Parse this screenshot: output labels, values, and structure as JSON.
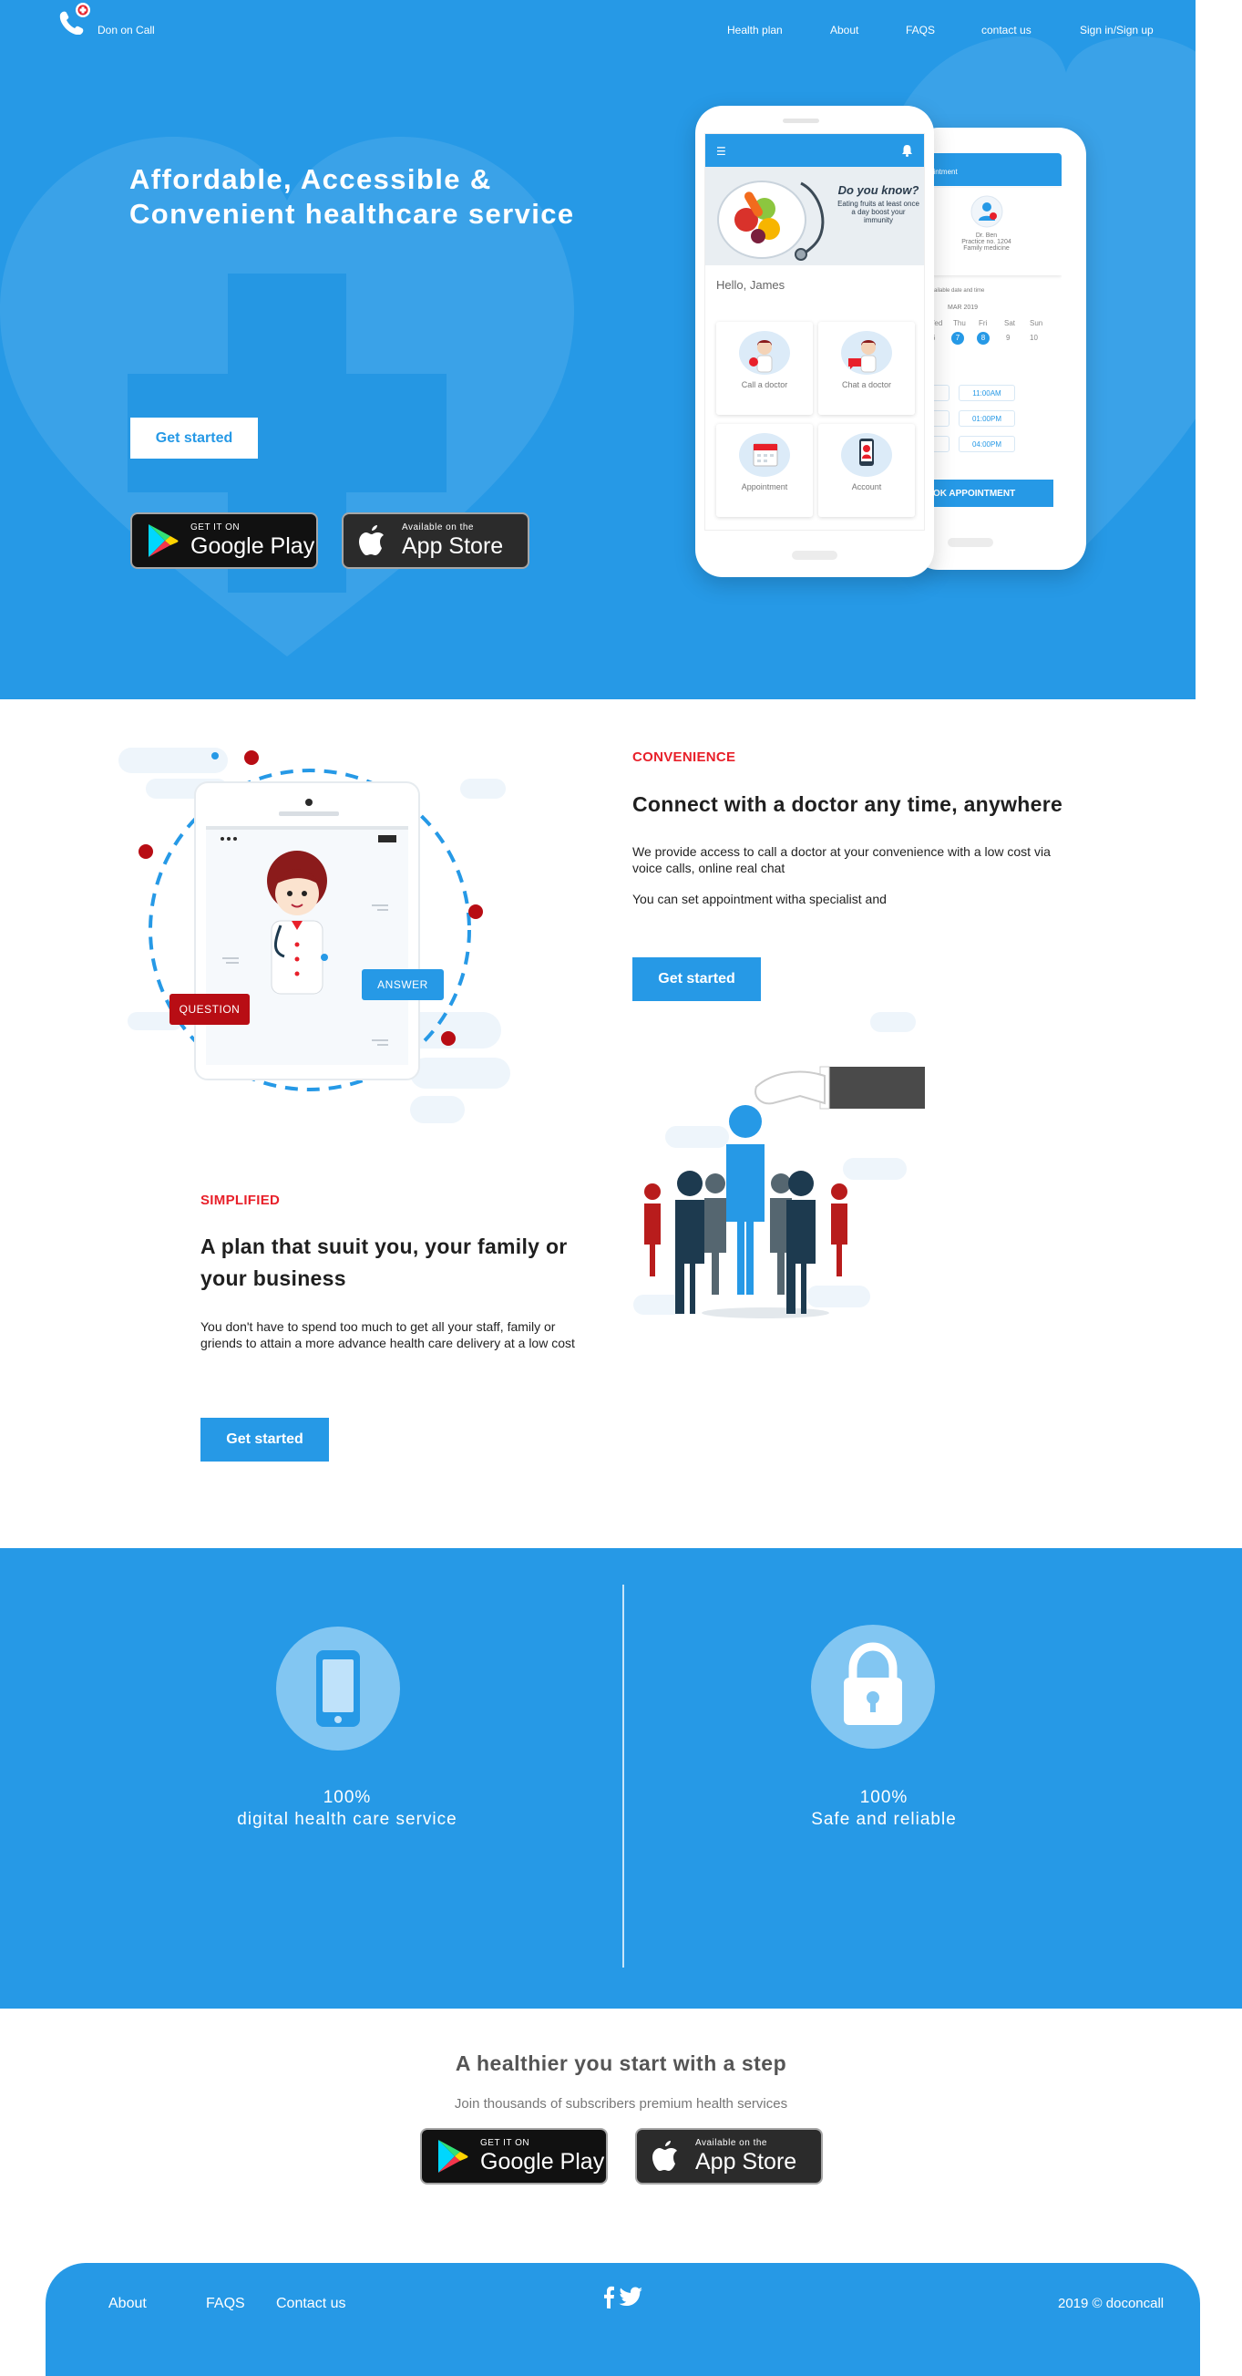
{
  "header": {
    "brand": "Don on Call",
    "nav": [
      "Health plan",
      "About",
      "FAQS",
      "contact us",
      "Sign in/Sign up"
    ]
  },
  "hero": {
    "title_line1": "Affordable, Accessible &",
    "title_line2": "Convenient healthcare service",
    "cta": "Get started",
    "google_play": {
      "small": "GET IT ON",
      "big": "Google Play"
    },
    "app_store": {
      "small": "Available on the",
      "big": "App Store"
    }
  },
  "phone_front": {
    "banner_title": "Do you know?",
    "banner_text": "Eating fruits at least once a day boost your immunity",
    "greeting": "Hello, James",
    "tiles": [
      "Call a doctor",
      "Chat a doctor",
      "Appointment",
      "Account"
    ]
  },
  "phone_back": {
    "title": "ointment",
    "doctor_name": "Dr. Ben",
    "practice": "Practice no. 1204",
    "specialty": "Family medicine",
    "instruction": "m the available date and time",
    "month": "MAR 2019",
    "days": [
      "Wed",
      "Thu",
      "Fri",
      "Sat",
      "Sun"
    ],
    "dates": [
      "6",
      "7",
      "8",
      "9",
      "10"
    ],
    "slots": [
      "00AM",
      "11:00AM",
      "00PM",
      "01:00PM",
      "00PM",
      "04:00PM"
    ],
    "book_button": "OK APPOINTMENT"
  },
  "convenience": {
    "label": "CONVENIENCE",
    "heading": "Connect with a doctor any time, anywhere",
    "body1": "We provide access to call a doctor at your convenience with a low cost via voice calls, online real chat",
    "body2": "You can set appointment witha specialist and",
    "cta": "Get started",
    "tag_question": "QUESTION",
    "tag_answer": "ANSWER"
  },
  "simplified": {
    "label": "SIMPLIFIED",
    "heading_line1": "A plan that suuit you, your family or",
    "heading_line2": "your business",
    "body": "You don't have to spend too much to get all your staff, family or griends to attain a more advance health care delivery at a low cost",
    "cta": "Get started"
  },
  "stats": [
    {
      "value": "100%",
      "label": "digital health care service",
      "icon": "phone-icon"
    },
    {
      "value": "100%",
      "label": "Safe and reliable",
      "icon": "lock-icon"
    }
  ],
  "cta_section": {
    "title": "A healthier you start with a step",
    "subtitle": "Join thousands of subscribers premium health services"
  },
  "footer": {
    "links": [
      "About",
      "FAQS",
      "Contact us"
    ],
    "social": [
      "facebook-icon",
      "twitter-icon"
    ],
    "copyright": "2019 © doconcall"
  },
  "colors": {
    "primary": "#2699e6",
    "accent_red": "#e8202a",
    "dark_red": "#b80d14",
    "navy": "#1d3a4f"
  }
}
